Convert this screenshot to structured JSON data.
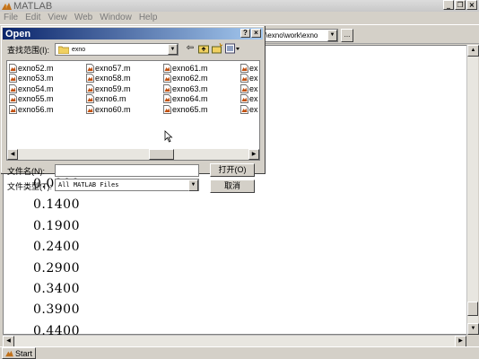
{
  "app": {
    "title": "MATLAB",
    "window_buttons": [
      "_",
      "❐",
      "×"
    ]
  },
  "menu": [
    {
      "label": "File",
      "key": "F"
    },
    {
      "label": "Edit",
      "key": "E"
    },
    {
      "label": "View",
      "key": "V"
    },
    {
      "label": "Web",
      "key": "W"
    },
    {
      "label": "Window",
      "key": "W"
    },
    {
      "label": "Help",
      "key": "H"
    }
  ],
  "toolbar": {
    "current_directory": "ork\\exno\\work\\exno",
    "browse_label": "..."
  },
  "command_window": {
    "output_values": [
      "0.0900",
      "0.1400",
      "0.1900",
      "0.2400",
      "0.2900",
      "0.3400",
      "0.3900",
      "0.4400"
    ],
    "vscroll_position": 0.97
  },
  "statusbar": {
    "start_label": "Start"
  },
  "dialog": {
    "title": "Open",
    "title_buttons": [
      "?",
      "×"
    ],
    "look_in_label": "查找范围(I):",
    "look_in_value": "exno",
    "files": [
      [
        "exno52.m",
        "exno57.m",
        "exno61.m",
        "ex"
      ],
      [
        "exno53.m",
        "exno58.m",
        "exno62.m",
        "ex"
      ],
      [
        "exno54.m",
        "exno59.m",
        "exno63.m",
        "ex"
      ],
      [
        "exno55.m",
        "exno6.m",
        "exno64.m",
        "ex"
      ],
      [
        "exno56.m",
        "exno60.m",
        "exno65.m",
        "ex"
      ]
    ],
    "file_name_label": "文件名(N):",
    "file_name_value": "",
    "file_type_label": "文件类型(T):",
    "file_type_value": "All MATLAB Files",
    "open_button": "打开(O)",
    "cancel_button": "取消"
  }
}
